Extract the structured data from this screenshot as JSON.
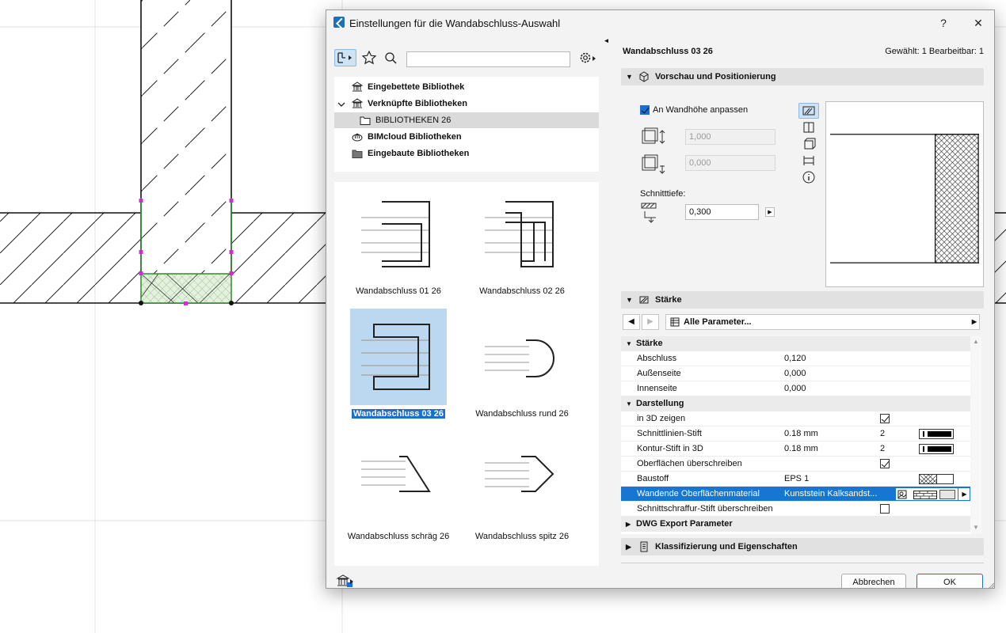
{
  "window": {
    "title": "Einstellungen für die Wandabschluss-Auswahl",
    "help": "?",
    "close": "✕"
  },
  "library_tree": [
    {
      "label": "Eingebettete Bibliothek",
      "icon": "library-building-icon"
    },
    {
      "label": "Verknüpfte Bibliotheken",
      "icon": "linked-library-icon",
      "expanded": true
    },
    {
      "label": "BIBLIOTHEKEN 26",
      "icon": "folder-icon"
    },
    {
      "label": "BIMcloud Bibliotheken",
      "icon": "bimcloud-icon"
    },
    {
      "label": "Eingebaute Bibliotheken",
      "icon": "folder-filled-icon"
    }
  ],
  "gallery": [
    {
      "label": "Wandabschluss 01 26"
    },
    {
      "label": "Wandabschluss 02 26"
    },
    {
      "label": "Wandabschluss 03 26",
      "selected": true
    },
    {
      "label": "Wandabschluss rund 26"
    },
    {
      "label": "Wandabschluss schräg 26"
    },
    {
      "label": "Wandabschluss spitz 26"
    }
  ],
  "header": {
    "object_name": "Wandabschluss 03 26",
    "selection_info": "Gewählt: 1 Bearbeitbar: 1"
  },
  "preview": {
    "section_title": "Vorschau und Positionierung",
    "fit_wall_height_label": "An Wandhöhe anpassen",
    "fit_wall_height_checked": true,
    "height_value": "1,000",
    "offset_value": "0,000",
    "cut_depth_label": "Schnitttiefe:",
    "cut_depth_value": "0,300"
  },
  "thickness_panel": {
    "section_title": "Stärke",
    "filter_label": "Alle Parameter..."
  },
  "properties": [
    {
      "type": "group",
      "label": "Stärke"
    },
    {
      "label": "Abschluss",
      "value": "0,120"
    },
    {
      "label": "Außenseite",
      "value": "0,000"
    },
    {
      "label": "Innenseite",
      "value": "0,000"
    },
    {
      "type": "group",
      "label": "Darstellung"
    },
    {
      "label": "in 3D zeigen",
      "check": true
    },
    {
      "label": "Schnittlinien-Stift",
      "value": "0.18 mm",
      "pen": "2"
    },
    {
      "label": "Kontur-Stift in 3D",
      "value": "0.18 mm",
      "pen": "2"
    },
    {
      "label": "Oberflächen überschreiben",
      "check": true
    },
    {
      "label": "Baustoff",
      "value": "EPS 1"
    },
    {
      "label": "Wandende Oberflächenmaterial",
      "value": "Kunststein Kalksandst...",
      "highlight": true
    },
    {
      "label": "Schnittschraffur-Stift überschreiben",
      "check": false
    },
    {
      "type": "group",
      "label": "DWG Export Parameter",
      "collapsed": true
    }
  ],
  "classification": {
    "section_title": "Klassifizierung und Eigenschaften"
  },
  "buttons": {
    "cancel": "Abbrechen",
    "ok": "OK"
  }
}
